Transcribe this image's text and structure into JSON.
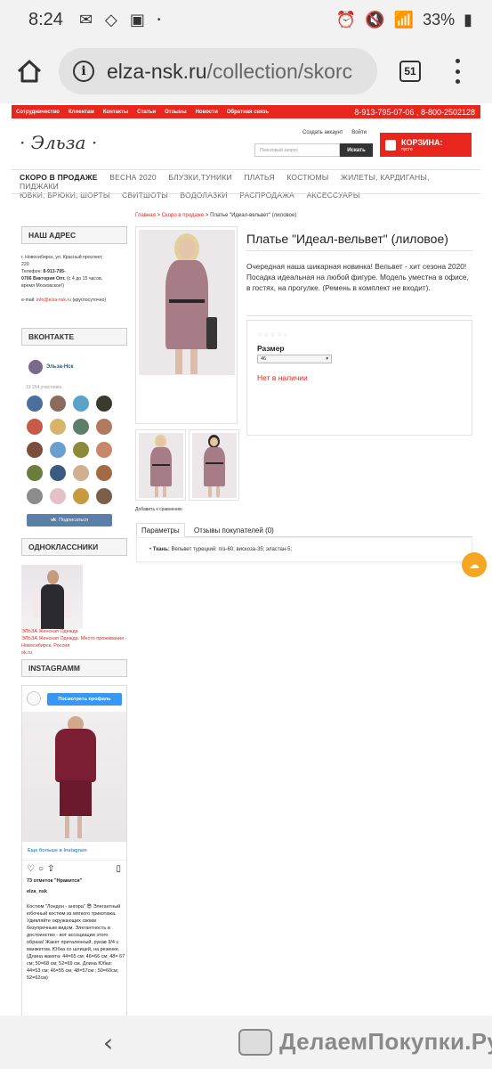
{
  "status": {
    "time": "8:24",
    "battery": "33%"
  },
  "browser": {
    "url_host": "elza-nsk.ru",
    "url_path": "/collection/skorc",
    "tab_count": "51"
  },
  "topnav": {
    "items": [
      "Сотрудничество",
      "Клиентам",
      "Контакты",
      "Статьи",
      "Отзывы",
      "Новости",
      "Обратная связь"
    ],
    "phones": "8-913-795-07-06 , 8-800-2502128"
  },
  "header": {
    "logo": "Эльза",
    "account": "Создать аккаунт",
    "login": "Войти",
    "search_placeholder": "Поисковый запрос",
    "search_button": "Искать",
    "cart_title": "КОРЗИНА:",
    "cart_sub": "пусто"
  },
  "catnav": {
    "row1": [
      "СКОРО В ПРОДАЖЕ",
      "ВЕСНА 2020",
      "БЛУЗКИ,ТУНИКИ",
      "ПЛАТЬЯ",
      "КОСТЮМЫ",
      "ЖИЛЕТЫ, КАРДИГАНЫ, ПИДЖАКИ"
    ],
    "row2": [
      "ЮБКИ, БРЮКИ, ШОРТЫ",
      "СВИТШОТЫ",
      "ВОДОЛАЗКИ",
      "РАСПРОДАЖА",
      "АКСЕССУАРЫ"
    ]
  },
  "sidebar": {
    "address_head": "НАШ АДРЕС",
    "address_line1": "г. Новосибирск, ул.  Красный проспект,",
    "address_line2": "220",
    "phone_label": "Телефон:",
    "phone_value": "8-913-795-",
    "phone_line2a": "0706",
    "phone_person": "Виктория",
    "phone_opt": "Опт.",
    "phone_hours": "(с 4 до 15 часов,",
    "phone_hours2": "время Московское!)",
    "email_label": "e-mail:",
    "email": "info@elza-nsk.ru",
    "email_note": "(круглосуточно)",
    "vk_head": "ВКОНТАКТЕ",
    "vk_name": "Эльза-Нск",
    "vk_count": "13 254 участника",
    "vk_subscribe": "Подписаться",
    "ok_head": "ОДНОКЛАССНИКИ",
    "ok_text1": "ЭЛЬЗА Женская Одежда",
    "ok_text2": "ЭЛЬЗА Женская Одежда. Место проживания - Новосибирск, Россия",
    "ok_text3": "ok.ru",
    "insta_head": "INSTAGRAMM",
    "insta_button": "Посмотреть профиль",
    "insta_more": "Еще больше в Instagram",
    "insta_likes": "73 отметок \"Нравится\"",
    "insta_user": "elza_nsk",
    "insta_caption": "Костюм \"Лондон - ангора\" 😎 Элегантный юбочный костюм из мягкого трикотажа. Удивляйте окружающих своим безупречным видом. Элегантность и достоинство - вот ассоциации этого образа! Жакет приталенный, рукав 3/4 с манжетом. Юбка со шлицей, на резинке. (Длина жакета: 44=65 см; 46=66 см; 48= 67 см; 50=68 см; 52=69 см. Длина Юбки: 44=53 см; 46=55 см; 48=57см ; 50=60см; 52=62см)"
  },
  "product": {
    "crumb_home": "Главная",
    "crumb_sep": " > ",
    "crumb_cat": "Скоро в продаже",
    "crumb_current": "Платье \"Идеал-вельвет\" (лиловое)",
    "title": "Платье \"Идеал-вельвет\" (лиловое)",
    "description": "Очередная наша шикарная новинка! Вельвет - хит сезона 2020! Посадка идеальная на любой фигуре. Модель уместна в офисе, в гостях, на прогулке. (Ремень в комплект не входит).",
    "rating_stars": "☆☆☆☆☆",
    "size_label": "Размер",
    "size_value": "46",
    "availability": "Нет в наличии",
    "compare": "Добавить к сравнению",
    "tab_params": "Параметры",
    "tab_reviews": "Отзывы покупателей (0)",
    "fabric_label": "Ткань:",
    "fabric_value": "Вельвет турецкий: п/э-60; вискоза-35; эластан-5;"
  },
  "watermark": "ДелаемПокупки.Ру",
  "colors": {
    "brand_red": "#e8261d",
    "vk_blue": "#5b7fa6",
    "insta_blue": "#3897f0",
    "orange": "#f5a623"
  }
}
